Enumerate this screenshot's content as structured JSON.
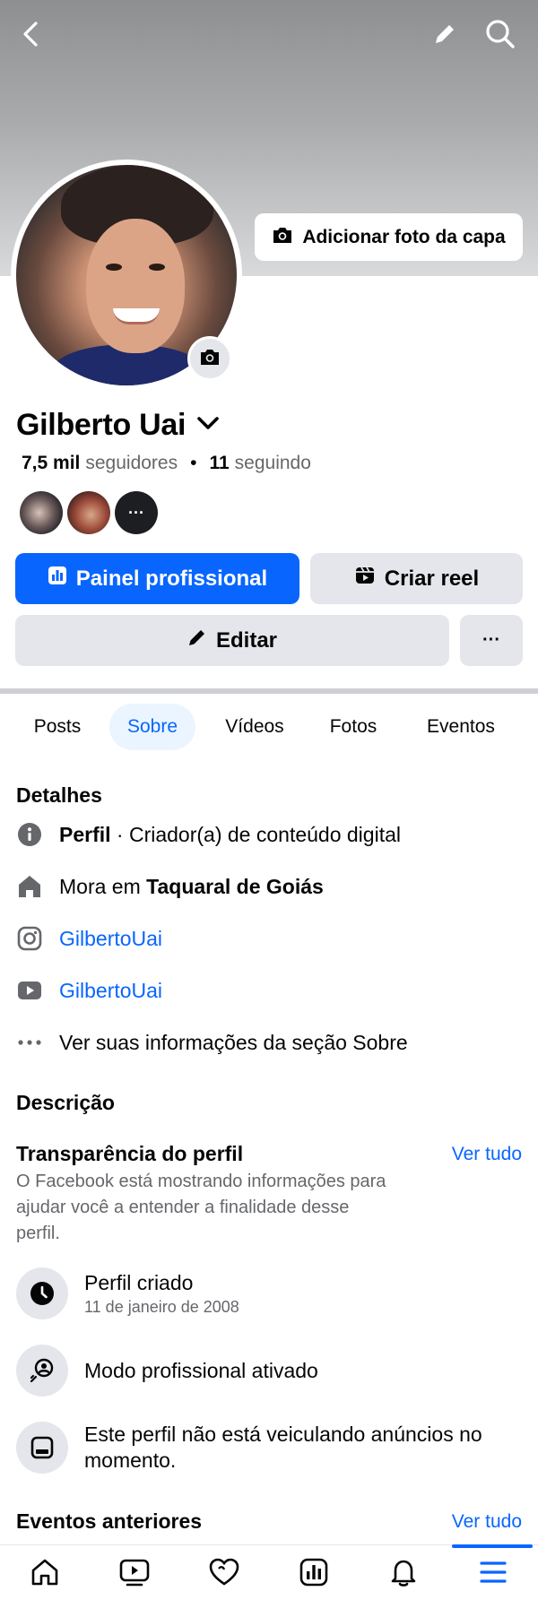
{
  "cover": {
    "add_cover_label": "Adicionar foto da capa"
  },
  "profile": {
    "name": "Gilberto Uai",
    "followers_count": "7,5 mil",
    "followers_label": "seguidores",
    "separator": "•",
    "following_count": "11",
    "following_label": "seguindo",
    "friend_more_label": "···"
  },
  "actions": {
    "professional_dashboard": "Painel profissional",
    "create_reel": "Criar reel",
    "edit": "Editar",
    "more": "···"
  },
  "tabs": [
    "Posts",
    "Sobre",
    "Vídeos",
    "Fotos",
    "Eventos"
  ],
  "active_tab": "Sobre",
  "details": {
    "title": "Detalhes",
    "profile_label": "Perfil",
    "profile_category": " · Criador(a) de conteúdo digital",
    "lives_in_prefix": "Mora em ",
    "lives_in_place": "Taquaral de Goiás",
    "instagram": "GilbertoUai",
    "youtube": "GilbertoUai",
    "see_about": "Ver suas informações da seção Sobre"
  },
  "description": {
    "title": "Descrição"
  },
  "transparency": {
    "title": "Transparência do perfil",
    "see_all": "Ver tudo",
    "description": "O Facebook está mostrando informações para ajudar você a entender a finalidade desse perfil.",
    "items": [
      {
        "title": "Perfil criado",
        "subtitle": "11 de janeiro de 2008",
        "icon": "clock-icon"
      },
      {
        "title": "Modo profissional ativado",
        "icon": "professional-mode-icon"
      },
      {
        "title": "Este perfil não está veiculando anúncios no momento.",
        "icon": "ads-icon"
      }
    ]
  },
  "past_events": {
    "title": "Eventos anteriores",
    "see_all": "Ver tudo"
  },
  "bottom_nav": [
    "home-icon",
    "video-icon",
    "dating-icon",
    "dashboard-icon",
    "notifications-icon",
    "menu-icon"
  ],
  "colors": {
    "accent": "#0866ff",
    "button_gray": "#e4e6eb",
    "tab_active_bg": "#ebf5ff",
    "secondary_text": "#65676b"
  }
}
